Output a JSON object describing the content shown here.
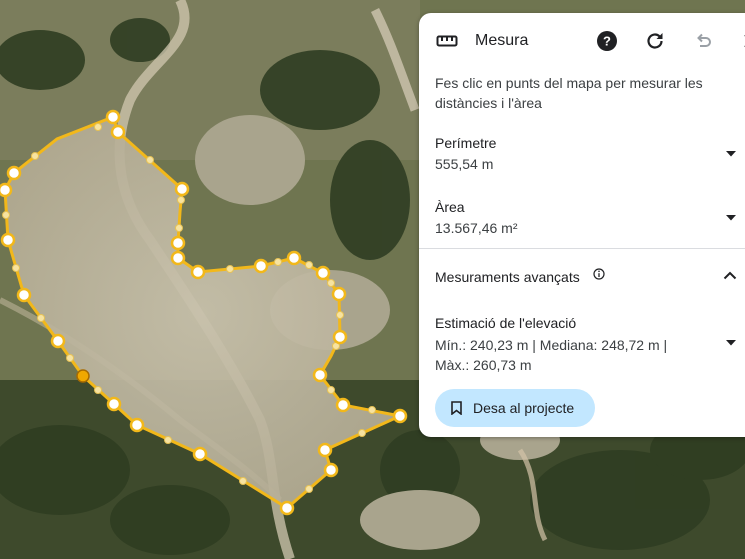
{
  "panel": {
    "title": "Mesura",
    "intro": "Fes clic en punts del mapa per mesurar les distàncies i l'àrea",
    "perimeter": {
      "label": "Perímetre",
      "value": "555,54 m"
    },
    "area": {
      "label": "Àrea",
      "value": "13.567,46 m²"
    },
    "advanced": {
      "label": "Mesuraments avançats"
    },
    "elevation": {
      "label": "Estimació de l'elevació",
      "values": "Mín.: 240,23 m | Mediana: 248,72 m | Màx.: 260,73 m"
    },
    "save_label": "Desa al projecte"
  },
  "icons": {
    "ruler": "ruler-icon",
    "help": "help-icon",
    "reset": "refresh-icon",
    "undo": "undo-icon",
    "close": "close-icon",
    "info": "info-icon",
    "bookmark": "bookmark-icon"
  },
  "colors": {
    "measure_line": "#f2b81a",
    "vertex_fill": "#ffffff",
    "active_vertex": "#f0a800",
    "save_button": "#c2e7ff"
  }
}
